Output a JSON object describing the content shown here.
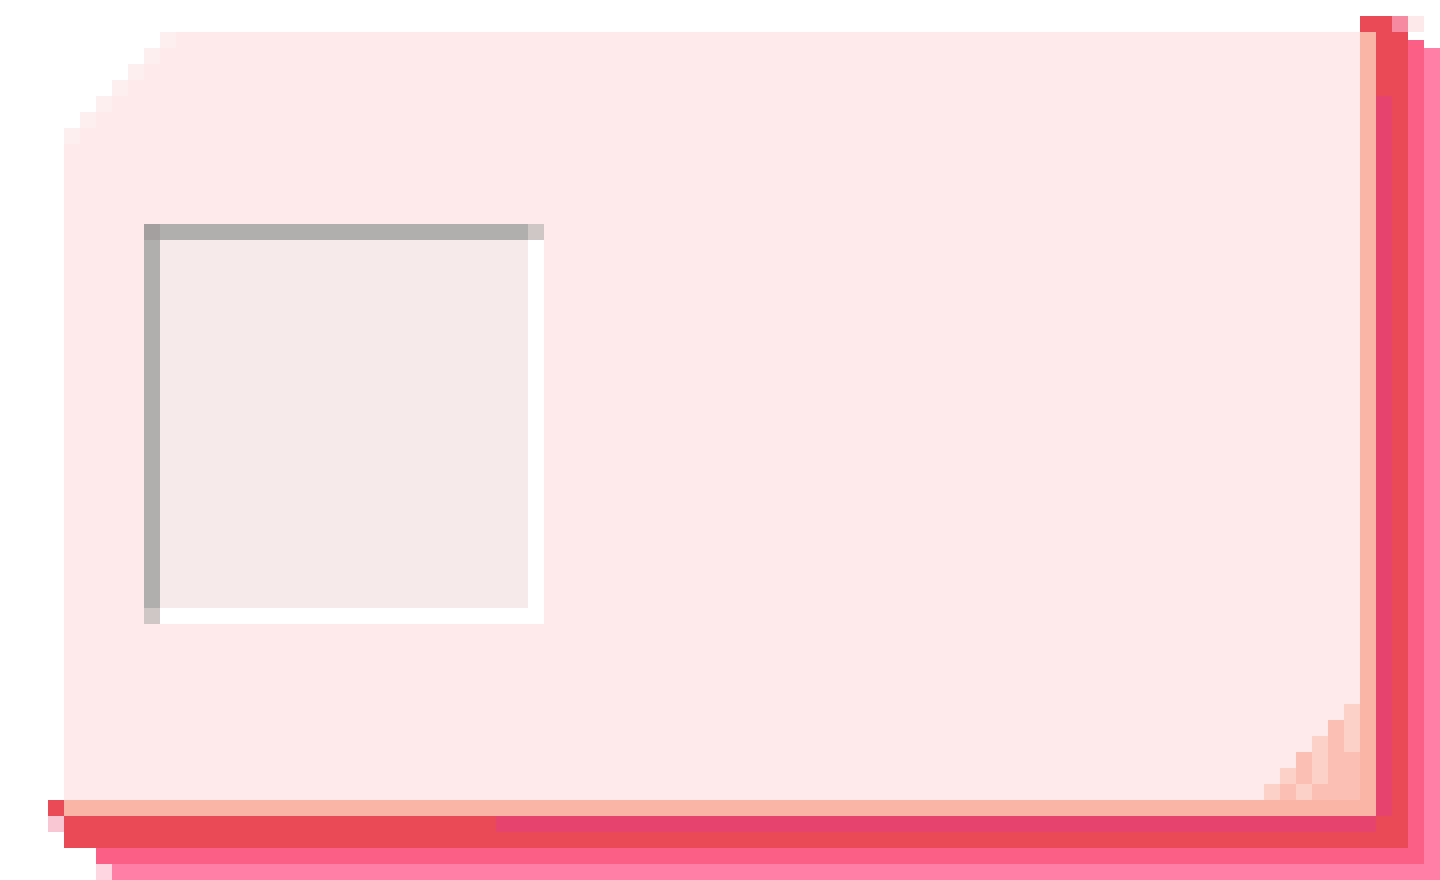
{
  "window": {
    "title": ""
  },
  "card": {
    "accent_color": "#ea4a55",
    "body_color": "#feeaea",
    "rim_color": "#fbb5a6",
    "shadow_colors": [
      "#ea4a55",
      "#e6436f",
      "#fb5f86",
      "#ff7fa6"
    ]
  },
  "inset_panel": {
    "fill_color": "#f7eaea",
    "border_dark": "#b1afad",
    "border_light": "#ffffff"
  }
}
